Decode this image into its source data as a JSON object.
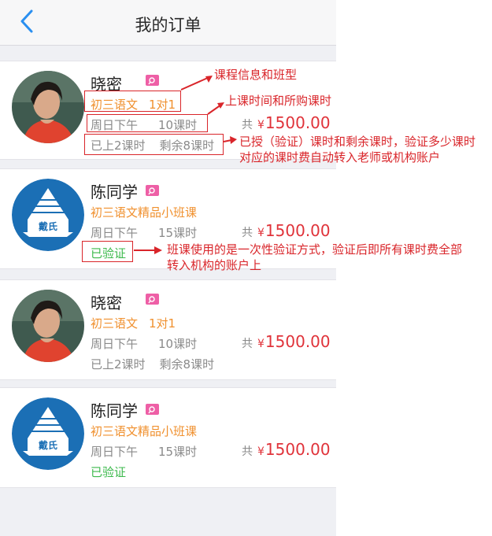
{
  "header": {
    "title": "我的订单"
  },
  "orders": [
    {
      "name": "晓密",
      "course": "初三语文",
      "class_type": "1对1",
      "time": "周日下午",
      "hours": "10课时",
      "total_prefix": "共",
      "currency": "¥",
      "price": "1500.00",
      "progress_done": "已上2课时",
      "progress_left": "剩余8课时"
    },
    {
      "name": "陈同学",
      "course": "初三语文精品小班课",
      "time": "周日下午",
      "hours": "15课时",
      "total_prefix": "共",
      "currency": "¥",
      "price": "1500.00",
      "status": "已验证",
      "logo_text": "戴氏"
    },
    {
      "name": "晓密",
      "course": "初三语文",
      "class_type": "1对1",
      "time": "周日下午",
      "hours": "10课时",
      "total_prefix": "共",
      "currency": "¥",
      "price": "1500.00",
      "progress_done": "已上2课时",
      "progress_left": "剩余8课时"
    },
    {
      "name": "陈同学",
      "course": "初三语文精品小班课",
      "time": "周日下午",
      "hours": "15课时",
      "total_prefix": "共",
      "currency": "¥",
      "price": "1500.00",
      "status": "已验证",
      "logo_text": "戴氏"
    }
  ],
  "annotations": {
    "course_info": "课程信息和班型",
    "class_time": "上课时间和所购课时",
    "progress_line1": "已授（验证）课时和剩余课时，验证多少课时",
    "progress_line2": "对应的课时费自动转入老师或机构账户",
    "verify_line1": "班课使用的是一次性验证方式，验证后即所有课时费全部",
    "verify_line2": "转入机构的账户上"
  },
  "colors": {
    "accent_orange": "#f0902e",
    "price_red": "#e0333a",
    "verified_green": "#3cb94c",
    "badge_pink": "#ee5fa6",
    "logo_blue": "#1b6fb5",
    "annotation_red": "#d9252a",
    "back_blue": "#2a8ff0"
  },
  "icons": {
    "back": "chevron-left-icon",
    "badge": "search-icon"
  }
}
